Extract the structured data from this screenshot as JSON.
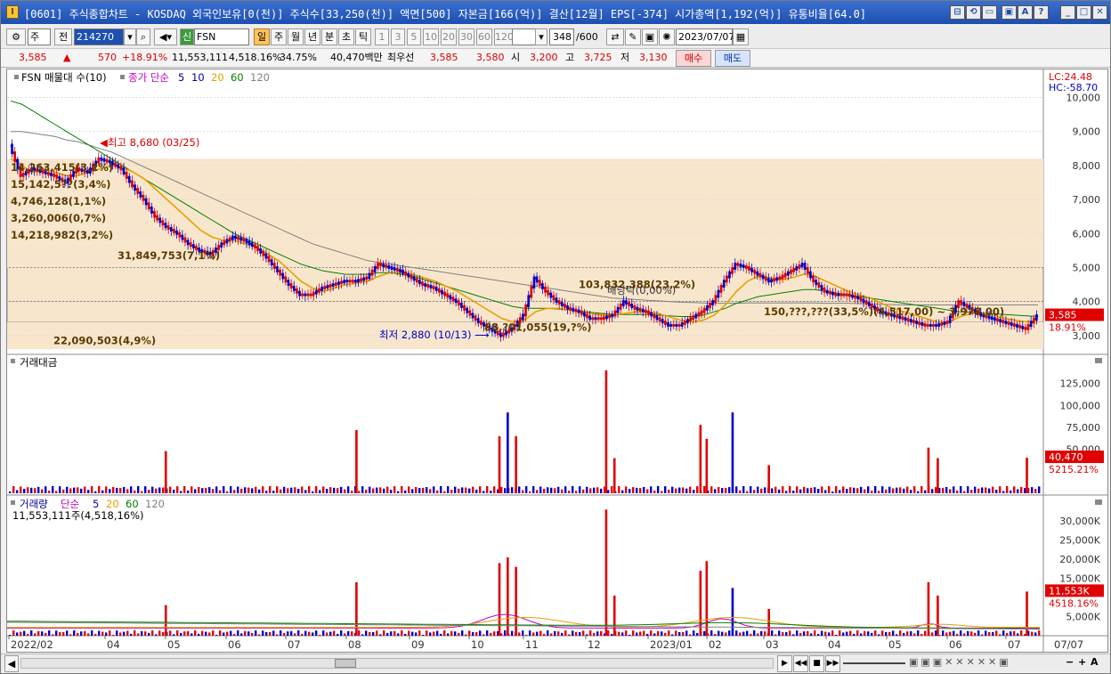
{
  "window": {
    "icon": "I",
    "title": "[0601] 주식종합차트 - KOSDAQ 외국인보유[0(천)] 주식수[33,250(천)] 액면[500] 자본금[166(억)] 결산[12월] EPS[-374] 시가총액[1,192(억)] 유통비율[64.0]",
    "buttons": [
      "restore-icon",
      "link-icon",
      "window-icon",
      "save-icon",
      "font-icon",
      "help-icon",
      "minimize-icon",
      "maximize-icon",
      "close-icon"
    ],
    "button_glyphs": [
      "⊟",
      "⟲",
      "▭",
      "▣",
      "A",
      "?",
      "_",
      "□",
      "✕"
    ]
  },
  "toolbar": {
    "market": "주",
    "prev_label": "전",
    "code": "214270",
    "cat_label": "신",
    "name": "FSN",
    "periods": [
      "일",
      "주",
      "월",
      "년",
      "분",
      "초",
      "틱"
    ],
    "active_period": "일",
    "minute_steps": [
      "1",
      "3",
      "5",
      "10",
      "20",
      "30",
      "60",
      "120"
    ],
    "count_value": "348",
    "count_total": "/600",
    "date": "2023/07/07"
  },
  "quote": {
    "price": "3,585",
    "change": "570",
    "change_pct": "+18.91%",
    "volume": "11,553,111",
    "vol_ratio": "4,518.16%",
    "turnover": "34.75%",
    "amount": "40,470백만",
    "best_ask_label": "최우선",
    "ask": "3,585",
    "bid": "3,580",
    "open_label": "시",
    "open": "3,200",
    "high_label": "고",
    "high": "3,725",
    "low_label": "저",
    "low": "3,130",
    "buy_label": "매수",
    "sell_label": "매도"
  },
  "colors": {
    "up": "#e00000",
    "down": "#0000c8",
    "ma5": "#0000a0",
    "ma20": "#e8a000",
    "ma60": "#008000",
    "ma120": "#808080",
    "band": "#f8e6cc"
  },
  "chart_data": [
    {
      "type": "candlestick",
      "legend": {
        "name": "FSN 매물대 수(10)",
        "ma_label": "종가 단순",
        "periods": [
          "5",
          "10",
          "20",
          "60",
          "120"
        ]
      },
      "x_ticks": [
        "2022/02",
        "04",
        "05",
        "06",
        "07",
        "08",
        "09",
        "10",
        "11",
        "12",
        "2023/01",
        "02",
        "03",
        "04",
        "05",
        "06",
        "07",
        "07/07"
      ],
      "y_ticks": [
        "10,000",
        "9,000",
        "8,000",
        "7,000",
        "6,000",
        "5,000",
        "4,000",
        "3,000"
      ],
      "y_tick_values": [
        10000,
        9000,
        8000,
        7000,
        6000,
        5000,
        4000,
        3000
      ],
      "ylim": [
        2500,
        10300
      ],
      "lc_label": "LC:24.48",
      "hc_label": "HC:-58.70",
      "price_tag": "3,585",
      "pct_tag": "18.91%",
      "close_series": [
        8600,
        7700,
        7900,
        7800,
        7700,
        7500,
        7900,
        7800,
        8200,
        8100,
        7900,
        7400,
        7000,
        6500,
        6200,
        6000,
        5700,
        5500,
        5400,
        5700,
        5900,
        5800,
        5600,
        5300,
        4900,
        4500,
        4200,
        4200,
        4400,
        4500,
        4600,
        4600,
        4700,
        5100,
        5000,
        4900,
        4700,
        4500,
        4400,
        4200,
        4000,
        3700,
        3400,
        3200,
        3000,
        3200,
        3600,
        4700,
        4300,
        4000,
        3800,
        3700,
        3500,
        3500,
        3600,
        4000,
        3800,
        3700,
        3500,
        3300,
        3300,
        3500,
        3700,
        4000,
        4600,
        5100,
        5000,
        4800,
        4600,
        4700,
        4900,
        5100,
        4600,
        4300,
        4200,
        4200,
        4100,
        3900,
        3700,
        3600,
        3500,
        3400,
        3300,
        3300,
        3400,
        4000,
        3800,
        3600,
        3500,
        3400,
        3300,
        3200,
        3585
      ],
      "ma20": [
        8200,
        8000,
        7800,
        7900,
        7800,
        7700,
        7700,
        7800,
        7900,
        8000,
        7950,
        7800,
        7600,
        7300,
        7000,
        6700,
        6400,
        6100,
        5900,
        5800,
        5800,
        5700,
        5600,
        5400,
        5200,
        4900,
        4600,
        4400,
        4300,
        4400,
        4500,
        4550,
        4600,
        4750,
        4850,
        4850,
        4800,
        4700,
        4600,
        4450,
        4300,
        4100,
        3900,
        3700,
        3500,
        3400,
        3450,
        3700,
        3800,
        3800,
        3750,
        3700,
        3650,
        3600,
        3600,
        3650,
        3700,
        3700,
        3650,
        3550,
        3450,
        3400,
        3450,
        3600,
        3900,
        4300,
        4600,
        4750,
        4700,
        4650,
        4700,
        4800,
        4750,
        4600,
        4450,
        4300,
        4200,
        4100,
        3950,
        3800,
        3700,
        3600,
        3500,
        3400,
        3400,
        3550,
        3650,
        3650,
        3600,
        3500,
        3450,
        3400,
        3450
      ],
      "ma60": [
        9900,
        9800,
        9600,
        9400,
        9200,
        9000,
        8800,
        8600,
        8400,
        8200,
        8000,
        7800,
        7600,
        7400,
        7200,
        7000,
        6800,
        6600,
        6400,
        6200,
        6000,
        5850,
        5700,
        5550,
        5400,
        5250,
        5100,
        5000,
        4900,
        4850,
        4800,
        4800,
        4800,
        4850,
        4850,
        4800,
        4750,
        4650,
        4550,
        4450,
        4350,
        4250,
        4150,
        4050,
        3950,
        3850,
        3800,
        3800,
        3800,
        3780,
        3760,
        3720,
        3680,
        3650,
        3620,
        3620,
        3620,
        3620,
        3600,
        3580,
        3560,
        3560,
        3600,
        3700,
        3800,
        3950,
        4050,
        4150,
        4200,
        4250,
        4300,
        4350,
        4350,
        4300,
        4250,
        4200,
        4150,
        4100,
        4050,
        4000,
        3950,
        3900,
        3850,
        3800,
        3750,
        3700,
        3680,
        3660,
        3640,
        3620,
        3600,
        3580,
        3560
      ],
      "ma120": [
        9000,
        9000,
        8950,
        8900,
        8850,
        8750,
        8700,
        8600,
        8500,
        8400,
        8250,
        8100,
        7950,
        7800,
        7650,
        7500,
        7350,
        7200,
        7050,
        6900,
        6750,
        6600,
        6450,
        6300,
        6150,
        6000,
        5850,
        5700,
        5600,
        5500,
        5400,
        5300,
        5200,
        5150,
        5100,
        5050,
        5000,
        4950,
        4900,
        4850,
        4800,
        4750,
        4700,
        4650,
        4600,
        4550,
        4500,
        4450,
        4400,
        4350,
        4300,
        4250,
        4200,
        4150,
        4100,
        4080,
        4060,
        4040,
        4020,
        4000,
        3980,
        3970,
        3960,
        3950,
        3950,
        3950,
        3960,
        3960,
        3960,
        3960,
        3960,
        3960,
        3960,
        3950,
        3950,
        3950,
        3940,
        3930,
        3920,
        3910,
        3900,
        3900,
        3900,
        3900,
        3900,
        3900,
        3900,
        3900,
        3900,
        3900,
        3900,
        3900,
        3900
      ],
      "volume_bands": [
        {
          "low": 7700,
          "high": 8200,
          "label": "14,263,415(3,2%)"
        },
        {
          "low": 7200,
          "high": 7700,
          "label": "15,142,5??(3,4%)"
        },
        {
          "low": 6700,
          "high": 7200,
          "label": "4,746,128(1,1%)"
        },
        {
          "low": 6200,
          "high": 6700,
          "label": "3,260,006(0,7%)"
        },
        {
          "low": 5700,
          "high": 6200,
          "label": "14,218,982(3,2%)"
        },
        {
          "low": 5000,
          "high": 5700,
          "label": "31,849,753(7,1%)"
        },
        {
          "low": 4000,
          "high": 5000,
          "label": "103,832,388(23,2%)"
        },
        {
          "low": 3400,
          "high": 4000,
          "label": "150,???,???(33,5%)(4,517,00) ~ 3,978,00)"
        },
        {
          "low": 3100,
          "high": 3400,
          "label": "88,?01,055(19,?%)"
        },
        {
          "low": 2600,
          "high": 3100,
          "label": "22,090,503(4,9%)"
        }
      ],
      "annotations": {
        "high": "최고 8,680 (03/25)",
        "low": "최저 2,880 (10/13)",
        "dividend": "배당락(0,00%)"
      }
    },
    {
      "type": "bar",
      "title": "거래대금",
      "y_ticks": [
        "125,000",
        "100,000",
        "75,000",
        "50,000"
      ],
      "y_tick_values": [
        125000,
        100000,
        75000,
        50000
      ],
      "ylim": [
        0,
        148000
      ],
      "value_tag": "40,470",
      "pct_tag": "5215.21%",
      "spikes": [
        {
          "x": 0.152,
          "value": 48000,
          "color": "up"
        },
        {
          "x": 0.336,
          "value": 72000,
          "color": "up"
        },
        {
          "x": 0.474,
          "value": 65000,
          "color": "up"
        },
        {
          "x": 0.482,
          "value": 92000,
          "color": "down"
        },
        {
          "x": 0.49,
          "value": 65000,
          "color": "up"
        },
        {
          "x": 0.577,
          "value": 140000,
          "color": "up"
        },
        {
          "x": 0.585,
          "value": 40000,
          "color": "up"
        },
        {
          "x": 0.668,
          "value": 78000,
          "color": "up"
        },
        {
          "x": 0.674,
          "value": 62000,
          "color": "up"
        },
        {
          "x": 0.699,
          "value": 92000,
          "color": "down"
        },
        {
          "x": 0.734,
          "value": 32000,
          "color": "up"
        },
        {
          "x": 0.888,
          "value": 52000,
          "color": "up"
        },
        {
          "x": 0.897,
          "value": 40000,
          "color": "up"
        },
        {
          "x": 0.983,
          "value": 40470,
          "color": "up"
        }
      ]
    },
    {
      "type": "bar",
      "title": "거래량",
      "ma_label": "단순",
      "ma_periods": [
        "5",
        "20",
        "60",
        "120"
      ],
      "subtitle": "11,553,111주(4,518,16%)",
      "y_ticks": [
        "30,000K",
        "25,000K",
        "20,000K",
        "15,000K",
        "5,000K"
      ],
      "y_tick_values": [
        30000,
        25000,
        20000,
        15000,
        5000
      ],
      "ylim": [
        0,
        34000
      ],
      "value_tag": "11,553K",
      "pct_tag": "4518.16%",
      "spikes": [
        {
          "x": 0.152,
          "value": 8000,
          "color": "up"
        },
        {
          "x": 0.336,
          "value": 14000,
          "color": "up"
        },
        {
          "x": 0.474,
          "value": 19000,
          "color": "up"
        },
        {
          "x": 0.482,
          "value": 20500,
          "color": "up"
        },
        {
          "x": 0.49,
          "value": 18000,
          "color": "up"
        },
        {
          "x": 0.577,
          "value": 33000,
          "color": "up"
        },
        {
          "x": 0.585,
          "value": 10500,
          "color": "up"
        },
        {
          "x": 0.668,
          "value": 17000,
          "color": "up"
        },
        {
          "x": 0.674,
          "value": 19500,
          "color": "up"
        },
        {
          "x": 0.699,
          "value": 12500,
          "color": "down"
        },
        {
          "x": 0.734,
          "value": 7000,
          "color": "up"
        },
        {
          "x": 0.888,
          "value": 14000,
          "color": "up"
        },
        {
          "x": 0.897,
          "value": 10500,
          "color": "up"
        },
        {
          "x": 0.983,
          "value": 11553,
          "color": "up"
        }
      ]
    }
  ],
  "scrollbar": {
    "nav_glyphs": [
      "▶",
      "◀◀",
      "■",
      "▶▶"
    ],
    "zoom_glyphs": [
      "−",
      "+",
      "A"
    ]
  }
}
